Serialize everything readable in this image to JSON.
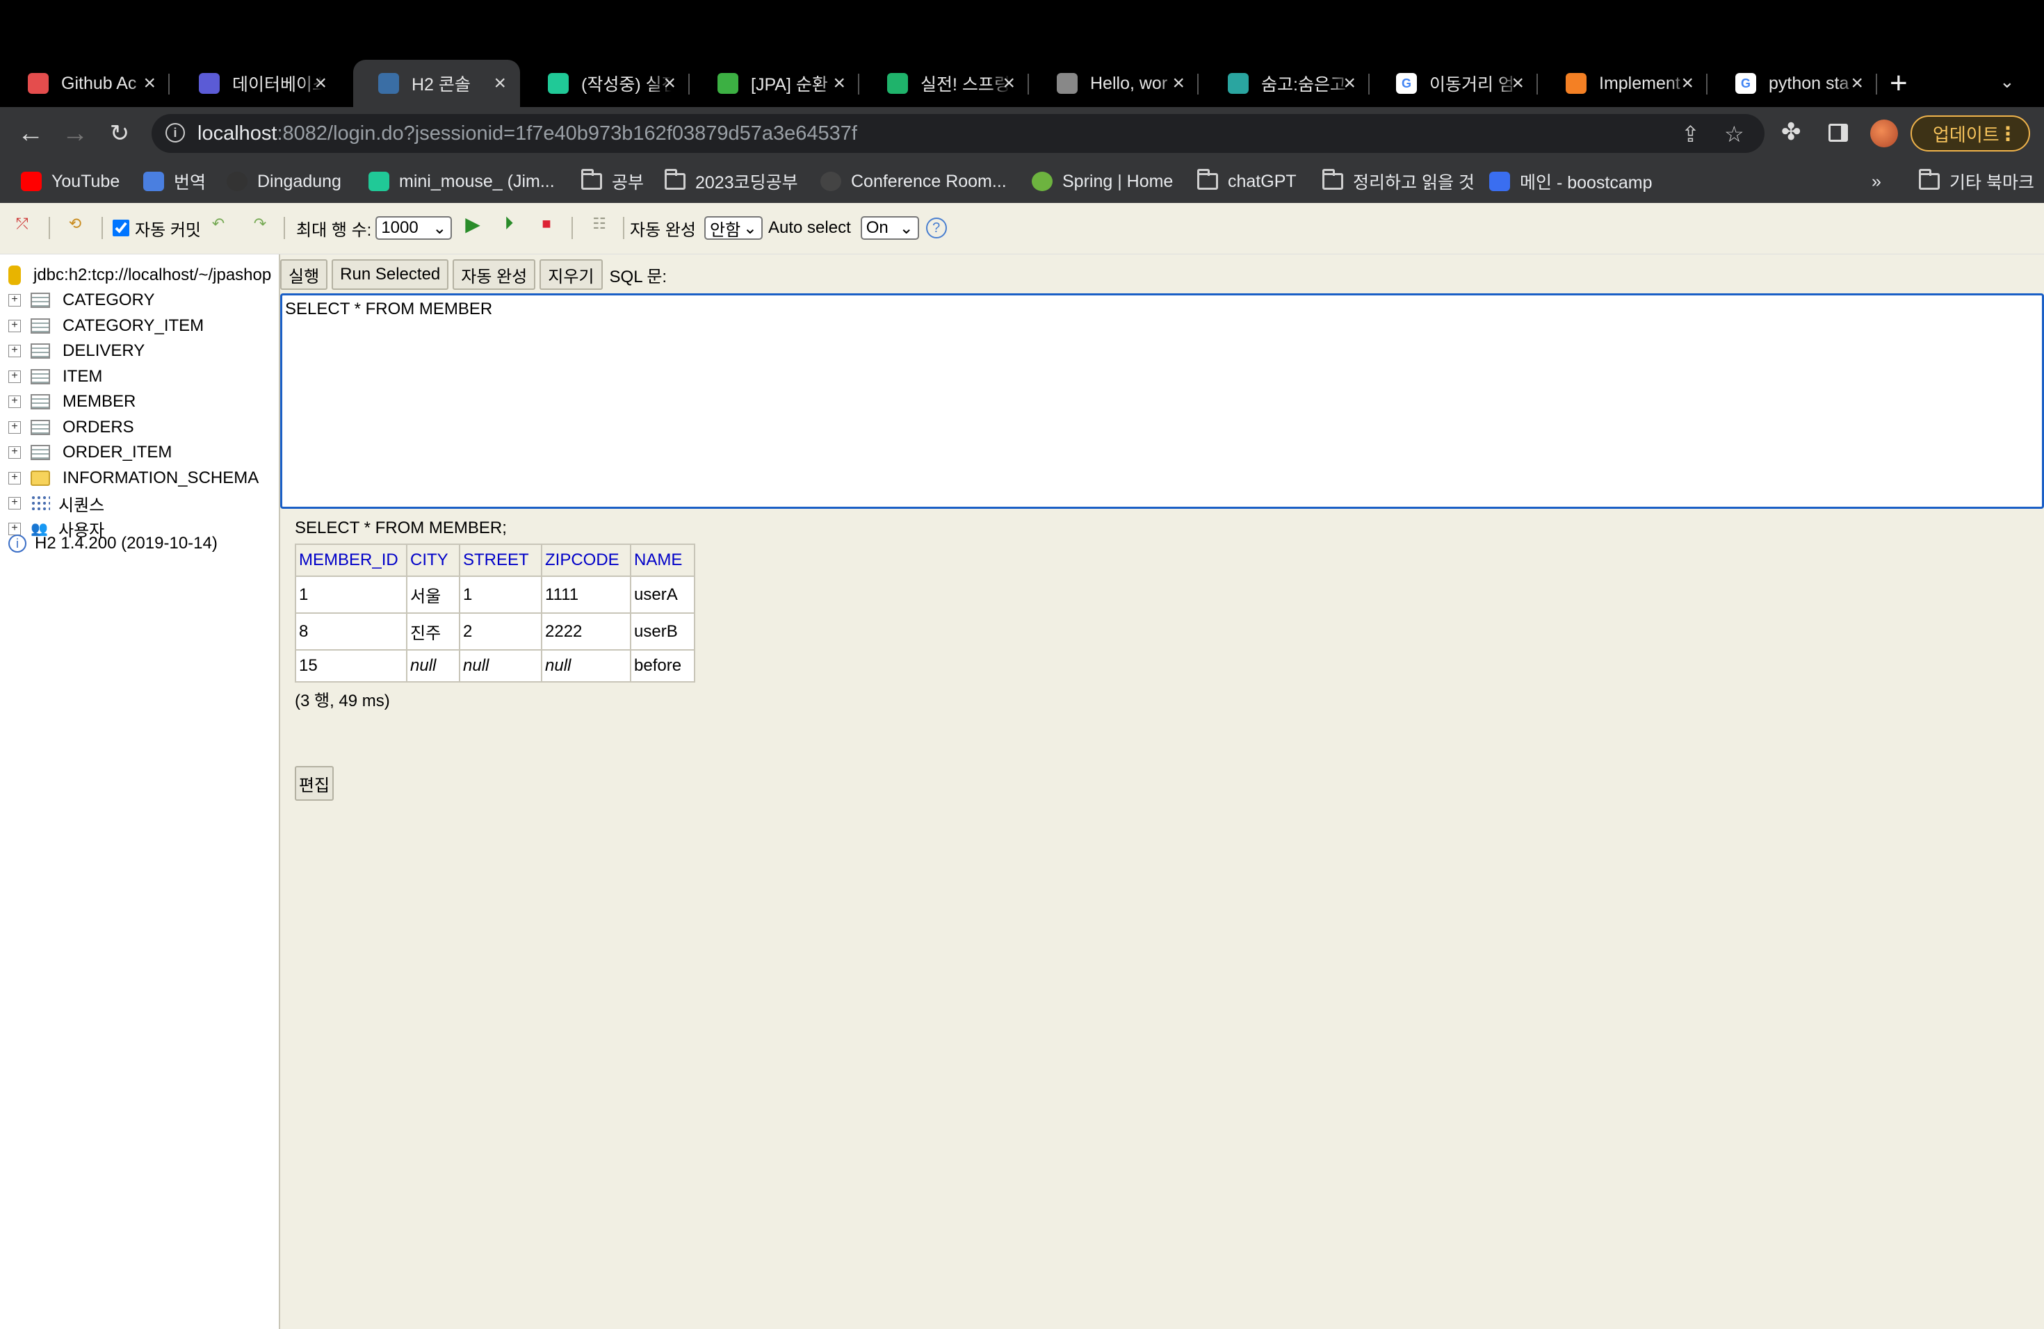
{
  "tabs": [
    {
      "title": "Github Ac",
      "icon": "github-actions-icon",
      "color": "#e44d4d"
    },
    {
      "title": "데이터베이스",
      "icon": "database-icon",
      "color": "#5b5bd6"
    },
    {
      "title": "H2 콘솔",
      "icon": "h2-icon",
      "color": "#3a6ea5"
    },
    {
      "title": "(작성중) 실전",
      "icon": "velog-icon",
      "color": "#20c997"
    },
    {
      "title": "[JPA] 순환",
      "icon": "chat-icon",
      "color": "#3cb043"
    },
    {
      "title": "실전! 스프링",
      "icon": "inflearn-icon",
      "color": "#1fb36b"
    },
    {
      "title": "Hello, wor",
      "icon": "globe-icon",
      "color": "#888888"
    },
    {
      "title": "숨고:숨은고수",
      "icon": "soomgo-icon",
      "color": "#2aa5a0"
    },
    {
      "title": "이동거리 엄",
      "icon": "google-icon",
      "color": "#ffffff"
    },
    {
      "title": "Implement",
      "icon": "stackoverflow-icon",
      "color": "#f48024"
    },
    {
      "title": "python sta",
      "icon": "google-icon",
      "color": "#ffffff"
    }
  ],
  "address": {
    "host": "localhost",
    "rest": ":8082/login.do?jsessionid=1f7e40b973b162f03879d57a3e64537f"
  },
  "update_label": "업데이트",
  "bookmarks": [
    {
      "label": "YouTube",
      "icon": "youtube-icon"
    },
    {
      "label": "번역",
      "icon": "translate-icon"
    },
    {
      "label": "Dingadung",
      "icon": "github-icon"
    },
    {
      "label": "mini_mouse_ (Jim...",
      "icon": "velog-icon"
    },
    {
      "label": "공부",
      "icon": "folder-icon"
    },
    {
      "label": "2023코딩공부",
      "icon": "folder-icon"
    },
    {
      "label": "Conference Room...",
      "icon": "chatgpt-icon"
    },
    {
      "label": "Spring | Home",
      "icon": "spring-icon"
    },
    {
      "label": "chatGPT",
      "icon": "folder-icon"
    },
    {
      "label": "정리하고 읽을 것",
      "icon": "folder-icon"
    },
    {
      "label": "메인 - boostcamp",
      "icon": "boostcamp-icon"
    }
  ],
  "bookmarks_more": "»",
  "other_bookmarks": "기타 북마크",
  "h2toolbar": {
    "autocommit_label": "자동 커밋",
    "autocommit_checked": true,
    "maxrows_label": "최대 행 수:",
    "maxrows_value": "1000",
    "autocomplete_label": "자동 완성",
    "autocomplete_value": "안함",
    "autoselect_label": "Auto select",
    "autoselect_value": "On",
    "help": "?"
  },
  "connection": "jdbc:h2:tcp://localhost/~/jpashop",
  "tree": [
    {
      "label": "CATEGORY",
      "type": "table"
    },
    {
      "label": "CATEGORY_ITEM",
      "type": "table"
    },
    {
      "label": "DELIVERY",
      "type": "table"
    },
    {
      "label": "ITEM",
      "type": "table"
    },
    {
      "label": "MEMBER",
      "type": "table"
    },
    {
      "label": "ORDERS",
      "type": "table"
    },
    {
      "label": "ORDER_ITEM",
      "type": "table"
    },
    {
      "label": "INFORMATION_SCHEMA",
      "type": "folder"
    },
    {
      "label": "시퀀스",
      "type": "sequence"
    },
    {
      "label": "사용자",
      "type": "users"
    }
  ],
  "version": "H2 1.4.200 (2019-10-14)",
  "sql_buttons": {
    "run": "실행",
    "run_selected": "Run Selected",
    "autocomplete": "자동 완성",
    "clear": "지우기",
    "sql_label": "SQL 문:"
  },
  "sql_text": "SELECT * FROM MEMBER",
  "result": {
    "query": "SELECT * FROM MEMBER;",
    "columns": [
      "MEMBER_ID",
      "CITY",
      "STREET",
      "ZIPCODE",
      "NAME"
    ],
    "rows": [
      [
        "1",
        "서울",
        "1",
        "1111",
        "userA"
      ],
      [
        "8",
        "진주",
        "2",
        "2222",
        "userB"
      ],
      [
        "15",
        "null",
        "null",
        "null",
        "before"
      ]
    ],
    "summary": "(3 행, 49 ms)",
    "edit_label": "편집"
  }
}
